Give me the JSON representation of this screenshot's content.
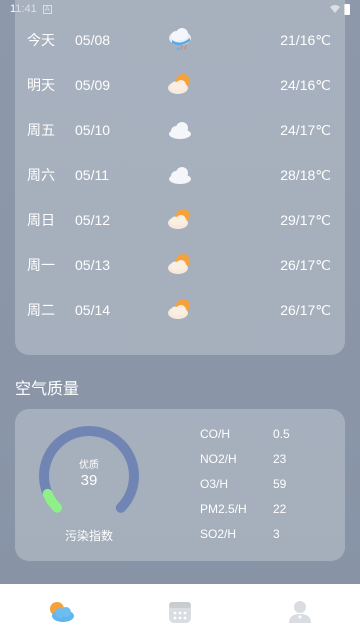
{
  "status": {
    "time": "11:41",
    "notif_glyph": "A"
  },
  "forecast": [
    {
      "day": "今天",
      "date": "05/08",
      "icon": "cloud-rain-icon",
      "temp": "21/16℃"
    },
    {
      "day": "明天",
      "date": "05/09",
      "icon": "sun-cloud-icon",
      "temp": "24/16℃"
    },
    {
      "day": "周五",
      "date": "05/10",
      "icon": "cloud-icon",
      "temp": "24/17℃"
    },
    {
      "day": "周六",
      "date": "05/11",
      "icon": "cloud-icon",
      "temp": "28/18℃"
    },
    {
      "day": "周日",
      "date": "05/12",
      "icon": "sun-cloud-icon",
      "temp": "29/17℃"
    },
    {
      "day": "周一",
      "date": "05/13",
      "icon": "sun-cloud-icon",
      "temp": "26/17℃"
    },
    {
      "day": "周二",
      "date": "05/14",
      "icon": "sun-cloud-icon",
      "temp": "26/17℃"
    }
  ],
  "air_quality": {
    "title": "空气质量",
    "level": "优质",
    "index": "39",
    "index_fraction": 0.08,
    "caption": "污染指数",
    "pollutants": [
      {
        "name": "CO/H",
        "value": "0.5"
      },
      {
        "name": "NO2/H",
        "value": "23"
      },
      {
        "name": "O3/H",
        "value": "59"
      },
      {
        "name": "PM2.5/H",
        "value": "22"
      },
      {
        "name": "SO2/H",
        "value": "3"
      }
    ],
    "colors": {
      "ring": "#7085b3",
      "progress": "#8ff08a"
    }
  },
  "nav": [
    {
      "icon": "weather-icon",
      "active": true
    },
    {
      "icon": "calendar-icon",
      "active": false
    },
    {
      "icon": "profile-icon",
      "active": false
    }
  ]
}
